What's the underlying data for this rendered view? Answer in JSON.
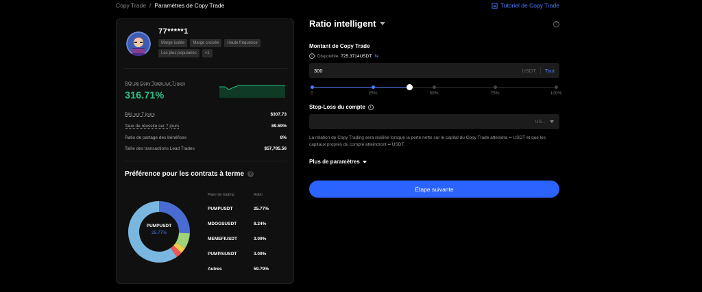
{
  "breadcrumb": {
    "parent": "Copy Trade",
    "separator": "/",
    "current": "Paramètres de Copy Trade"
  },
  "tutorial_link": "Tutoriel de Copy Trade",
  "trader": {
    "name": "77*****1",
    "tags": [
      "Marge isolée",
      "Marge croisée",
      "Haute fréquence",
      "Les plus populaires",
      "+1"
    ]
  },
  "roi": {
    "label": "ROI de Copy Trade sur 7 jours",
    "value": "316.71%"
  },
  "stats": [
    {
      "label": "PAL sur 7 jours",
      "value": "$307.73",
      "underline": true
    },
    {
      "label": "Taux de réussite sur 7 jours",
      "value": "89.69%",
      "underline": true
    },
    {
      "label": "Ratio de partage des bénéfices",
      "value": "8%",
      "underline": false
    },
    {
      "label": "Taille des transactions Lead Trades",
      "value": "$57,785.56",
      "underline": false
    }
  ],
  "preference": {
    "title": "Préférence pour les contrats à terme",
    "col_pair": "Paire de trading",
    "col_ratio": "Ratio",
    "center_label": "PUMPUSDT",
    "center_value": "25.77%",
    "rows": [
      {
        "pair": "PUMPUSDT",
        "ratio": "25.77%",
        "pct": 25.77,
        "color": "#4a6bd1"
      },
      {
        "pair": "MDOGSUSDT",
        "ratio": "8.24%",
        "pct": 8.24,
        "color": "#9ed37a"
      },
      {
        "pair": "MEMEFIUSDT",
        "ratio": "3.09%",
        "pct": 3.09,
        "color": "#f2c94c"
      },
      {
        "pair": "PUMPAIUSDT",
        "ratio": "3.09%",
        "pct": 3.09,
        "color": "#eb5757"
      },
      {
        "pair": "Autres",
        "ratio": "59.79%",
        "pct": 59.79,
        "color": "#7ab7e0"
      }
    ]
  },
  "form": {
    "title": "Ratio intelligent",
    "amount_title": "Montant de Copy Trade",
    "available_label": "Disponible",
    "available_value": "725.3714USDT",
    "amount_value": "300",
    "amount_unit": "USDT",
    "amount_all": "Tout",
    "slider_percent": 40,
    "slider_marks": [
      "0",
      "25%",
      "50%",
      "75%",
      "100%"
    ],
    "stoploss_title": "Stop-Loss du compte",
    "stoploss_unit": "US...",
    "description_1": "La relation de Copy Trading sera résiliée lorsque la perte nette sur le capital du Copy Trade atteindra",
    "description_dash1": "--",
    "description_2": "USDT et que les capitaux propres du compte atteindront",
    "description_dash2": "--",
    "description_3": "USDT.",
    "more_params": "Plus de paramètres",
    "next_button": "Étape suivante"
  },
  "colors": {
    "accent": "#2b63ff",
    "roi_green": "#27c281",
    "link": "#4d7cfe"
  }
}
